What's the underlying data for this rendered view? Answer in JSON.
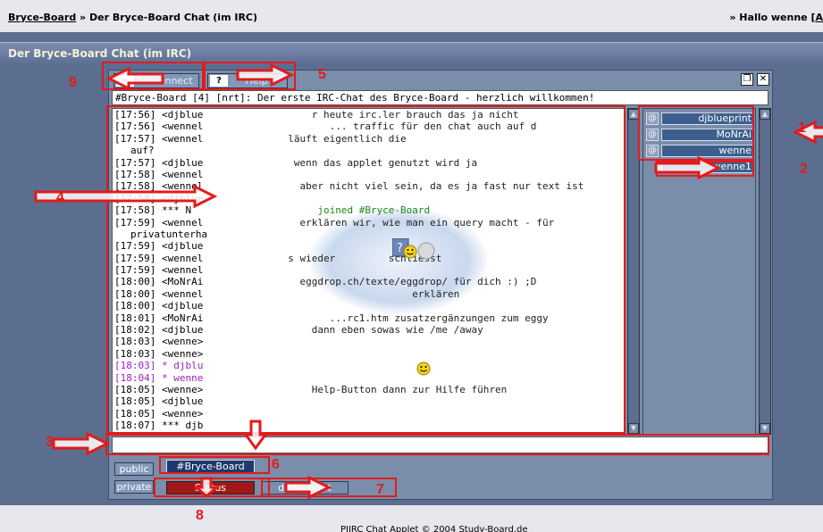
{
  "forum": {
    "site_link": "Bryce-Board",
    "sep": "»",
    "crumb_current": "Der Bryce-Board Chat (im IRC)",
    "hello_prefix": "» Hallo wenne [",
    "hello_link": "A",
    "section_title": "Der Bryce-Board Chat (im IRC)",
    "footer_text": "PJIRC Chat Applet © 2004 Study-Board.de"
  },
  "toolbar": {
    "disconnect_label": "Disconnect",
    "disconnect_icon": "plug-icon",
    "help_label": "Help",
    "help_icon_glyph": "?"
  },
  "topic": "#Bryce-Board [4] [nrt]: Der erste IRC-Chat des Bryce-Board - herzlich willkommen!",
  "chat_lines": [
    {
      "text": "[17:56] <djblue",
      "kind": "msg"
    },
    {
      "text": "[17:56] <wennel",
      "kind": "msg"
    },
    {
      "text": "[17:57] <wennel",
      "kind": "msg"
    },
    {
      "text": "auf?",
      "kind": "cont"
    },
    {
      "text": "[17:57] <djblue",
      "kind": "msg"
    },
    {
      "text": "[17:58] <wennel",
      "kind": "msg"
    },
    {
      "text": "[17:58] <wennel",
      "kind": "msg"
    },
    {
      "text": "[17:58] <djblue",
      "kind": "msg"
    },
    {
      "text": "[17:58] *** N",
      "kind": "sys"
    },
    {
      "text": "[17:59] <wennel",
      "kind": "msg"
    },
    {
      "text": "privatunterha",
      "kind": "cont"
    },
    {
      "text": "[17:59] <djblue",
      "kind": "msg"
    },
    {
      "text": "[17:59] <wennel",
      "kind": "msg"
    },
    {
      "text": "[17:59] <wennel",
      "kind": "msg"
    },
    {
      "text": "[18:00] <MoNrAi",
      "kind": "msg"
    },
    {
      "text": "[18:00] <wennel",
      "kind": "msg"
    },
    {
      "text": "[18:00] <djblue",
      "kind": "msg"
    },
    {
      "text": "[18:01] <MoNrAi",
      "kind": "msg"
    },
    {
      "text": "[18:02] <djblue",
      "kind": "msg"
    },
    {
      "text": "[18:03] <wenne>",
      "kind": "msg"
    },
    {
      "text": "[18:03] <wenne>",
      "kind": "msg"
    },
    {
      "text": "[18:03] * djblu",
      "kind": "act"
    },
    {
      "text": "[18:04] * wenne",
      "kind": "act"
    },
    {
      "text": "[18:05] <wenne>",
      "kind": "msg"
    },
    {
      "text": "[18:05] <djblue",
      "kind": "msg"
    },
    {
      "text": "[18:05] <wenne>",
      "kind": "msg"
    },
    {
      "text": "[18:07] *** djb",
      "kind": "sys"
    },
    {
      "text": "[18:07] *** MoN",
      "kind": "sys"
    }
  ],
  "splash_lines": [
    {
      "text": "              r heute irc.ler brauch das ja nicht",
      "kind": "n"
    },
    {
      "text": "                 ... traffic für den chat auch auf d",
      "kind": "n"
    },
    {
      "text": "          läuft eigentlich die",
      "kind": "n"
    },
    {
      "text": "",
      "kind": "n"
    },
    {
      "text": "           wenn das applet genutzt wird ja",
      "kind": "n"
    },
    {
      "text": "",
      "kind": "n"
    },
    {
      "text": "            aber nicht viel sein, da es ja fast nur text ist",
      "kind": "n"
    },
    {
      "text": "",
      "kind": "n"
    },
    {
      "text": "               joined #Bryce-Board",
      "kind": "g"
    },
    {
      "text": "            erklären wir, wie man ein query macht - für",
      "kind": "n"
    },
    {
      "text": "",
      "kind": "n"
    },
    {
      "text": "",
      "kind": "n"
    },
    {
      "text": "          s wieder         schliesst",
      "kind": "n"
    },
    {
      "text": "",
      "kind": "n"
    },
    {
      "text": "            eggdrop.ch/texte/eggdrop/ für dich :) ;D",
      "kind": "n"
    },
    {
      "text": "                               erklären",
      "kind": "n"
    },
    {
      "text": "",
      "kind": "n"
    },
    {
      "text": "                 ...rc1.htm zusatzergänzungen zum eggy",
      "kind": "n"
    },
    {
      "text": "              dann eben sowas wie /me /away",
      "kind": "n"
    },
    {
      "text": "",
      "kind": "n"
    },
    {
      "text": "",
      "kind": "n"
    },
    {
      "text": "",
      "kind": "n"
    },
    {
      "text": "",
      "kind": "n"
    },
    {
      "text": "              Help-Button dann zur Hilfe führen",
      "kind": "n"
    },
    {
      "text": "",
      "kind": "n"
    },
    {
      "text": "",
      "kind": "n"
    },
    {
      "text": "",
      "kind": "n"
    },
    {
      "text": "",
      "kind": "n"
    }
  ],
  "nicklist": [
    {
      "nick": "djblueprint",
      "mode": "@"
    },
    {
      "nick": "MoNrAi",
      "mode": "@"
    },
    {
      "nick": "wenne",
      "mode": "@"
    },
    {
      "nick": "wenne1",
      "mode": ""
    }
  ],
  "input": {
    "value": "",
    "placeholder": ""
  },
  "groups": {
    "public_label": "public",
    "private_label": "private"
  },
  "tabs": {
    "public": [
      "#Bryce-Board"
    ],
    "status_label": "Status",
    "private": [
      "djblueprint"
    ]
  },
  "annotations": [
    "1",
    "2",
    "3",
    "4",
    "5",
    "6",
    "7",
    "8",
    "9"
  ],
  "colors": {
    "annotation": "#e31b1b",
    "page_bg": "#5b6e8f",
    "active_tab": "#1e3a6a",
    "status_tab": "#a01818"
  }
}
